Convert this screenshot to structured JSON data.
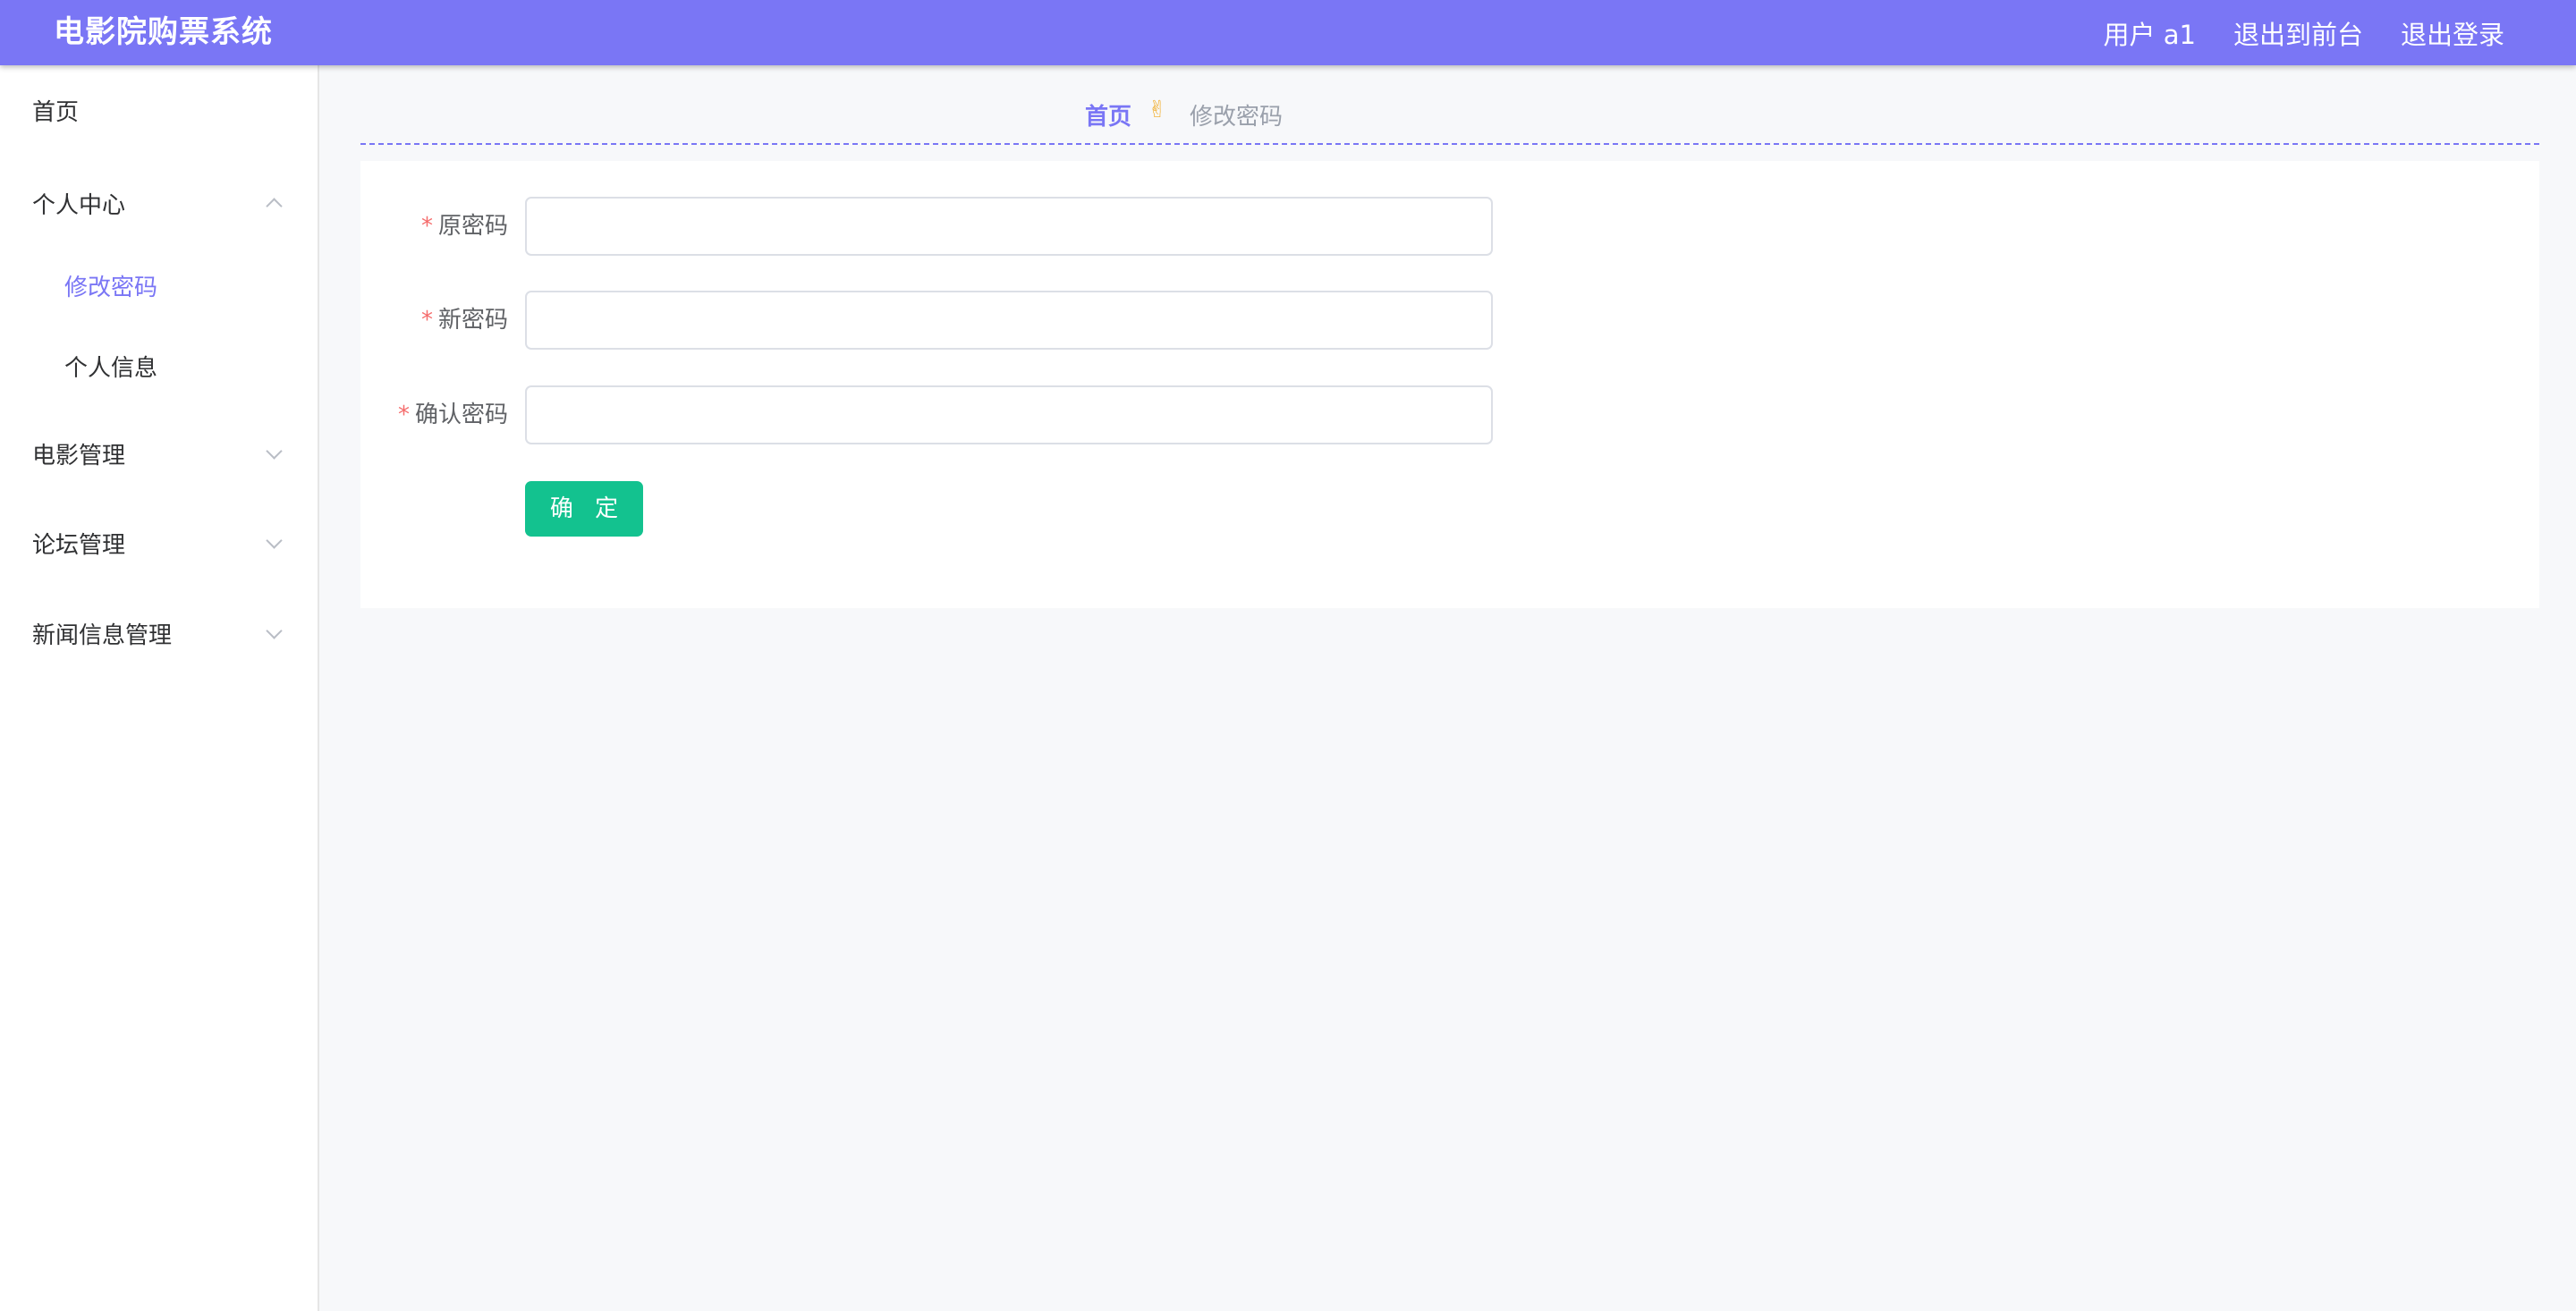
{
  "header": {
    "title": "电影院购票系统",
    "user_label": "用户 a1",
    "exit_to_front": "退出到前台",
    "logout": "退出登录",
    "accent_color": "#7a76f5"
  },
  "sidebar": {
    "items": [
      {
        "label": "首页",
        "has_arrow": false
      },
      {
        "label": "个人中心",
        "expanded": true,
        "children": [
          {
            "label": "修改密码",
            "active": true
          },
          {
            "label": "个人信息",
            "active": false
          }
        ]
      },
      {
        "label": "电影管理",
        "expanded": false
      },
      {
        "label": "论坛管理",
        "expanded": false
      },
      {
        "label": "新闻信息管理",
        "expanded": false
      }
    ]
  },
  "breadcrumb": {
    "home": "首页",
    "separator_icon": "victory-hand-icon",
    "current": "修改密码"
  },
  "form": {
    "fields": [
      {
        "label": "原密码",
        "required": true,
        "value": "",
        "placeholder": ""
      },
      {
        "label": "新密码",
        "required": true,
        "value": "",
        "placeholder": ""
      },
      {
        "label": "确认密码",
        "required": true,
        "value": "",
        "placeholder": ""
      }
    ],
    "required_mark": "*",
    "submit_label": "确 定",
    "submit_color": "#13c28f"
  }
}
